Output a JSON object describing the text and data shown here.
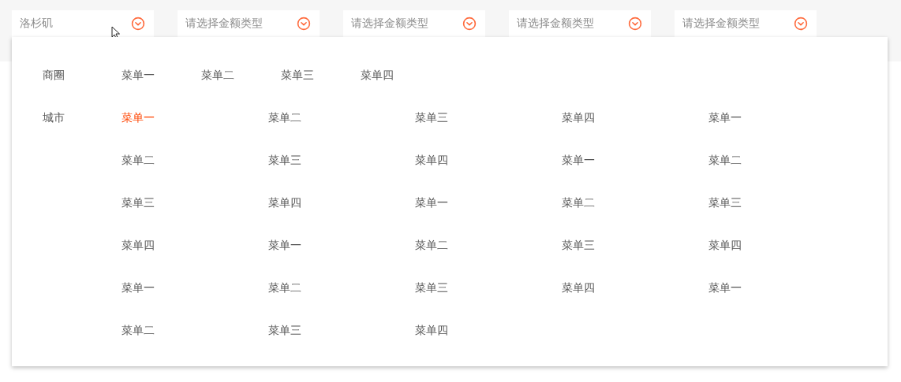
{
  "selects": [
    {
      "value": "洛杉矶"
    },
    {
      "placeholder": "请选择金额类型"
    },
    {
      "placeholder": "请选择金额类型"
    },
    {
      "placeholder": "请选择金额类型"
    },
    {
      "placeholder": "请选择金额类型"
    }
  ],
  "panel": {
    "groups": [
      {
        "label": "商圈",
        "kind": "inline",
        "items": [
          {
            "label": "菜单一",
            "selected": false
          },
          {
            "label": "菜单二",
            "selected": false
          },
          {
            "label": "菜单三",
            "selected": false
          },
          {
            "label": "菜单四",
            "selected": false
          }
        ]
      },
      {
        "label": "城市",
        "kind": "grid",
        "items": [
          {
            "label": "菜单一",
            "selected": true
          },
          {
            "label": "菜单二",
            "selected": false
          },
          {
            "label": "菜单三",
            "selected": false
          },
          {
            "label": "菜单四",
            "selected": false
          },
          {
            "label": "菜单一",
            "selected": false
          },
          {
            "label": "菜单二",
            "selected": false
          },
          {
            "label": "菜单三",
            "selected": false
          },
          {
            "label": "菜单四",
            "selected": false
          },
          {
            "label": "菜单一",
            "selected": false
          },
          {
            "label": "菜单二",
            "selected": false
          },
          {
            "label": "菜单三",
            "selected": false
          },
          {
            "label": "菜单四",
            "selected": false
          },
          {
            "label": "菜单一",
            "selected": false
          },
          {
            "label": "菜单二",
            "selected": false
          },
          {
            "label": "菜单三",
            "selected": false
          },
          {
            "label": "菜单四",
            "selected": false
          },
          {
            "label": "菜单一",
            "selected": false
          },
          {
            "label": "菜单二",
            "selected": false
          },
          {
            "label": "菜单三",
            "selected": false
          },
          {
            "label": "菜单四",
            "selected": false
          },
          {
            "label": "菜单一",
            "selected": false
          },
          {
            "label": "菜单二",
            "selected": false
          },
          {
            "label": "菜单三",
            "selected": false
          },
          {
            "label": "菜单四",
            "selected": false
          },
          {
            "label": "菜单一",
            "selected": false
          },
          {
            "label": "菜单二",
            "selected": false
          },
          {
            "label": "菜单三",
            "selected": false
          },
          {
            "label": "菜单四",
            "selected": false
          }
        ]
      }
    ]
  }
}
